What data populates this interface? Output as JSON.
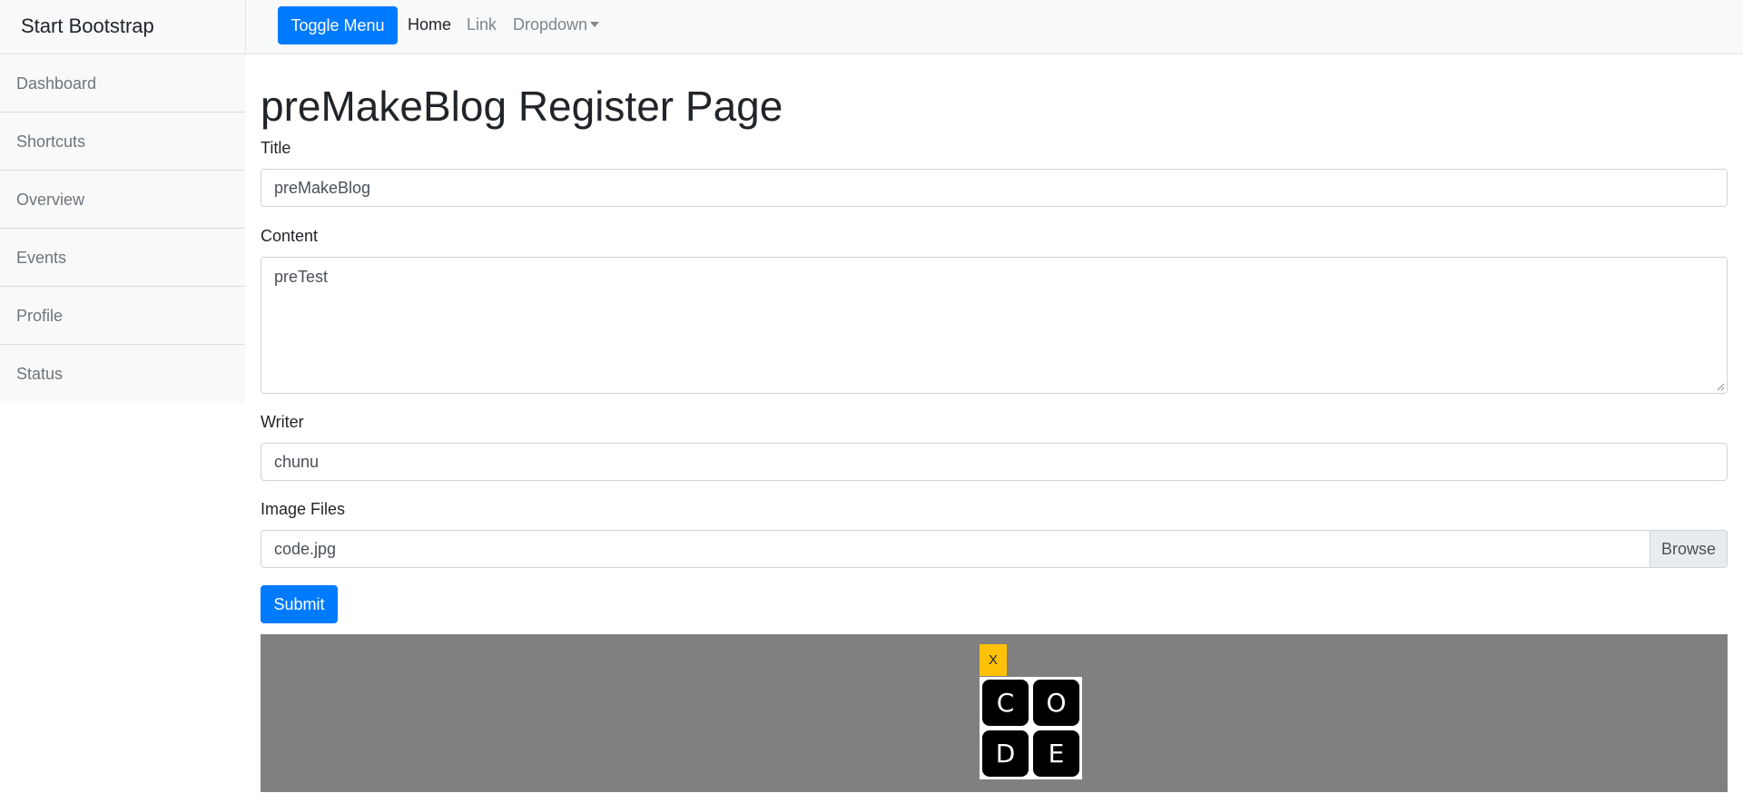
{
  "sidebar": {
    "heading": "Start Bootstrap",
    "items": [
      {
        "label": "Dashboard"
      },
      {
        "label": "Shortcuts"
      },
      {
        "label": "Overview"
      },
      {
        "label": "Events"
      },
      {
        "label": "Profile"
      },
      {
        "label": "Status"
      }
    ]
  },
  "navbar": {
    "toggle_label": "Toggle Menu",
    "home_label": "Home",
    "link_label": "Link",
    "dropdown_label": "Dropdown"
  },
  "page": {
    "title": "preMakeBlog Register Page"
  },
  "form": {
    "title_label": "Title",
    "title_value": "preMakeBlog",
    "content_label": "Content",
    "content_value": "preTest",
    "writer_label": "Writer",
    "writer_value": "chunu",
    "image_label": "Image Files",
    "image_file_name": "code.jpg",
    "browse_label": "Browse",
    "submit_label": "Submit"
  },
  "preview": {
    "remove_label": "X",
    "tiles": [
      "C",
      "O",
      "D",
      "E"
    ]
  },
  "colors": {
    "primary": "#007bff",
    "warning": "#ffc107",
    "preview_bg": "#808080",
    "navbar_bg": "#f8f9fa"
  }
}
